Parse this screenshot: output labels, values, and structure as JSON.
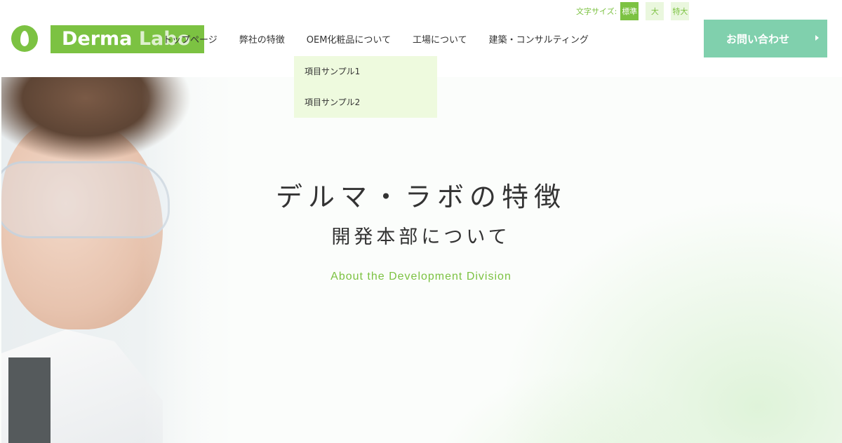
{
  "brand": {
    "logo_text_1": "Derma",
    "logo_text_2": "Labo",
    "accent": "#7cc242",
    "contact_color": "#80d0ad"
  },
  "font_size_selector": {
    "label": "文字サイズ:",
    "options": [
      "標準",
      "大",
      "特大"
    ],
    "selected": "標準"
  },
  "nav": {
    "items": [
      "トップページ",
      "弊社の特徴",
      "OEM化粧品について",
      "工場について",
      "建築・コンサルティング"
    ]
  },
  "dropdown": {
    "items": [
      "項目サンプル1",
      "項目サンプル2"
    ]
  },
  "contact": {
    "label": "お問い合わせ",
    "icon": "chevron-right-icon"
  },
  "hero": {
    "title": "デルマ・ラボの特徴",
    "subtitle": "開発本部について",
    "english": "About the Development Division"
  }
}
